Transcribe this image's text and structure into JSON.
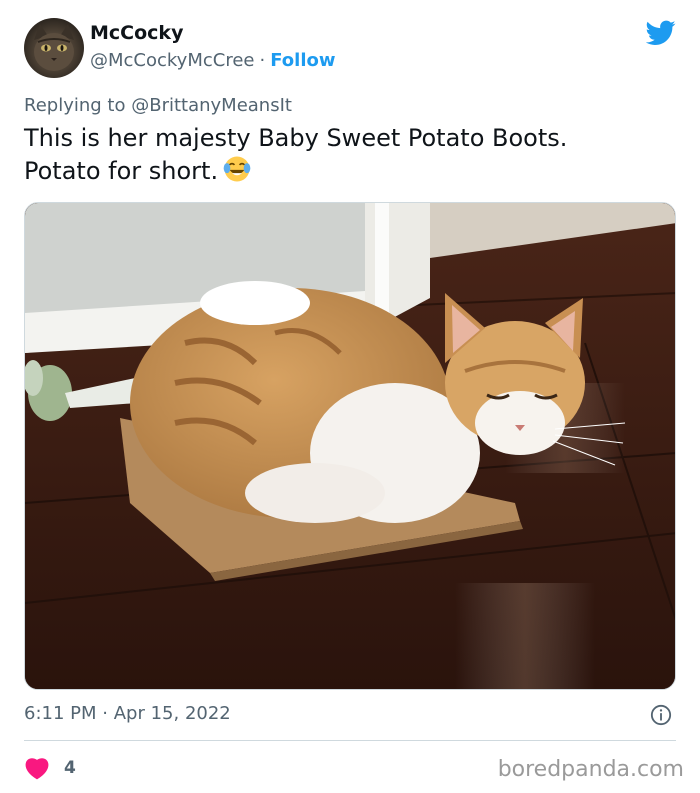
{
  "author": {
    "name": "McCocky",
    "handle": "@McCockyMcCree",
    "separator": "·",
    "follow_label": "Follow"
  },
  "reply": {
    "prefix": "Replying to",
    "to": "@BrittanyMeansIt"
  },
  "tweet": {
    "line1": "This is her majesty Baby Sweet Potato Boots.",
    "line2": "Potato for short.",
    "emoji": "face-with-tears-of-joy"
  },
  "meta": {
    "time": "6:11 PM",
    "separator": "·",
    "date": "Apr 15, 2022"
  },
  "engagement": {
    "likes": "4"
  },
  "watermark": "boredpanda.com",
  "icons": {
    "platform": "twitter-bird-icon",
    "info": "info-icon",
    "like": "heart-icon"
  },
  "colors": {
    "accent": "#1d9bf0",
    "like": "#f91880",
    "muted": "#536471",
    "text": "#0f1419"
  }
}
